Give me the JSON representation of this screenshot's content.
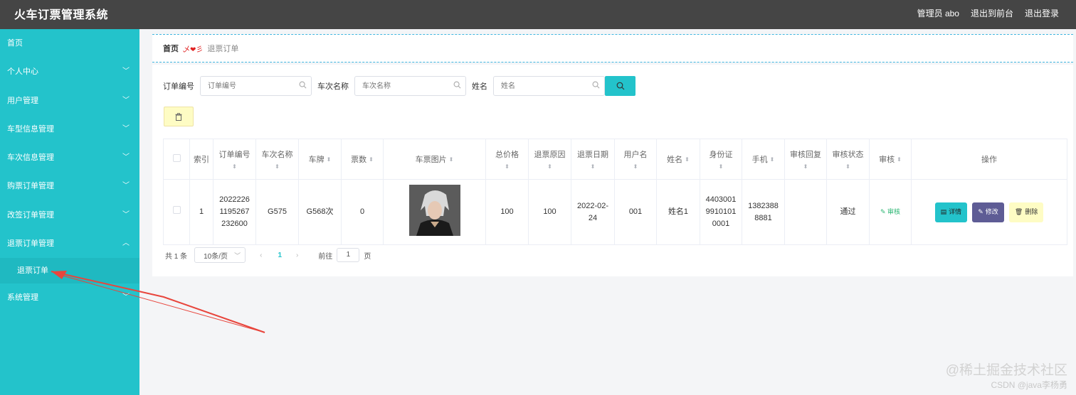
{
  "app": {
    "title": "火车订票管理系统"
  },
  "topbar": {
    "user": "管理员 abo",
    "to_front": "退出到前台",
    "logout": "退出登录"
  },
  "sidebar": {
    "items": [
      {
        "label": "首页"
      },
      {
        "label": "个人中心"
      },
      {
        "label": "用户管理"
      },
      {
        "label": "车型信息管理"
      },
      {
        "label": "车次信息管理"
      },
      {
        "label": "购票订单管理"
      },
      {
        "label": "改签订单管理"
      },
      {
        "label": "退票订单管理"
      },
      {
        "label": "退票订单"
      },
      {
        "label": "系统管理"
      }
    ]
  },
  "breadcrumb": {
    "home": "首页",
    "separator": "乄❤彡",
    "current": "退票订单"
  },
  "search": {
    "order_no_label": "订单编号",
    "order_no_placeholder": "订单编号",
    "train_label": "车次名称",
    "train_placeholder": "车次名称",
    "name_label": "姓名",
    "name_placeholder": "姓名"
  },
  "table": {
    "headers": [
      "索引",
      "订单编号",
      "车次名称",
      "车牌",
      "票数",
      "车票图片",
      "总价格",
      "退票原因",
      "退票日期",
      "用户名",
      "姓名",
      "身份证",
      "手机",
      "审核回复",
      "审核状态",
      "审核",
      "操作"
    ],
    "row": {
      "index": "1",
      "order_no": "20222261195267232600",
      "train": "G575",
      "plate": "G568次",
      "count": "0",
      "total": "100",
      "reason": "100",
      "date": "2022-02-24",
      "username": "001",
      "name": "姓名1",
      "id_card": "440300199101010001",
      "phone": "13823888881",
      "reply": "",
      "status": "通过",
      "audit": "审核"
    },
    "actions": {
      "detail": "详情",
      "edit": "修改",
      "delete": "删除"
    }
  },
  "pager": {
    "total": "共 1 条",
    "size": "10条/页",
    "page": "1",
    "goto": "前往",
    "jump": "1",
    "unit": "页"
  },
  "watermark": {
    "line1": "@稀土掘金技术社区",
    "line2": "CSDN @java李杨勇"
  },
  "colors": {
    "sidebar": "#23c3cb",
    "topbar": "#454545",
    "accent": "#23c3cb",
    "arrow": "#e8453c"
  }
}
